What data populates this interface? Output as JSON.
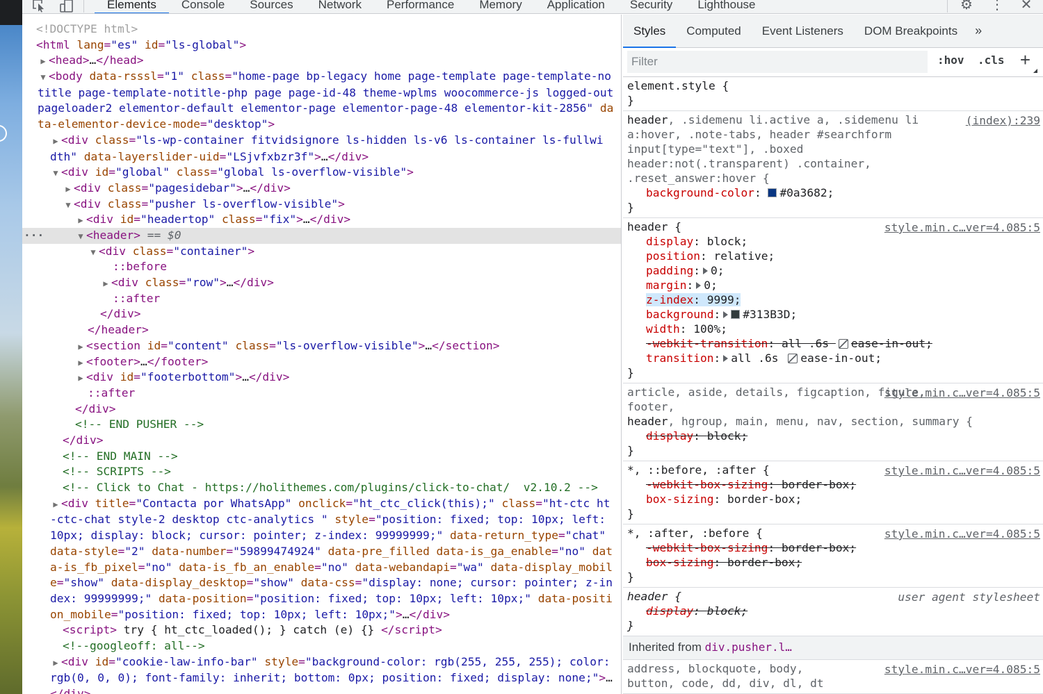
{
  "toolbar": {
    "tabs": [
      "Elements",
      "Console",
      "Sources",
      "Network",
      "Performance",
      "Memory",
      "Application",
      "Security",
      "Lighthouse"
    ],
    "active_tab": "Elements",
    "icons": [
      "inspect-element-icon",
      "device-toolbar-icon",
      "settings-gear-icon",
      "more-options-icon",
      "close-icon"
    ]
  },
  "elements": {
    "selected_suffix": "== $0",
    "lines": {
      "l0": "<!DOCTYPE html>",
      "l1_lang": "\"es\"",
      "l1_id": "\"ls-global\"",
      "l2_head": "…",
      "l3_rsssl": "\"1\"",
      "l3_class": "\"home-page bp-legacy home page-template page-template-notitle page-template-notitle-php page page-id-48 theme-wplms woocommerce-js logged-out pageloader2 elementor-default elementor-page elementor-page-48 elementor-kit-2856\"",
      "l3_mode": "\"desktop\"",
      "l4_class": "\"ls-wp-container fitvidsignore ls-hidden ls-v6 ls-container ls-fullwidth\"",
      "l4_uid": "\"LSjvfxbzr3f\"",
      "l5_id": "\"global\"",
      "l5_class": "\"global ls-overflow-visible\"",
      "l6_class": "\"pagesidebar\"",
      "l7_class": "\"pusher ls-overflow-visible\"",
      "l8_id": "\"headertop\"",
      "l8_class": "\"fix\"",
      "l10_class": "\"container\"",
      "l11": "::before",
      "l12_class": "\"row\"",
      "l13": "::after",
      "l16_id": "\"content\"",
      "l16_class": "\"ls-overflow-visible\"",
      "l18_id": "\"footerbottom\"",
      "l19": "::after",
      "c1": "<!-- END PUSHER -->",
      "c2": "<!-- END MAIN -->",
      "c3": "<!-- SCRIPTS -->",
      "c4": "<!-- Click to Chat - https://holithemes.com/plugins/click-to-chat/  v2.10.2 -->",
      "wa_title": "\"Contacta por WhatsApp\"",
      "wa_onclick": "\"ht_ctc_click(this);\"",
      "wa_class": "\"ht-ctc ht-ctc-chat style-2 desktop ctc-analytics \"",
      "wa_style": "\"position: fixed; top: 10px; left: 10px; display: block; cursor: pointer; z-index: 99999999;\"",
      "wa_return": "\"chat\"",
      "wa_dstyle": "\"2\"",
      "wa_number": "\"59899474924\"",
      "wa_ga": "\"no\"",
      "wa_fbpx": "\"no\"",
      "wa_fban": "\"no\"",
      "wa_api": "\"wa\"",
      "wa_mob": "\"show\"",
      "wa_desk": "\"show\"",
      "wa_css": "\"display: none; cursor: pointer; z-index: 99999999;\"",
      "wa_pos": "\"position: fixed; top: 10px; left: 10px;\"",
      "wa_posm": "\"position: fixed; top: 10px; left: 10px;\"",
      "script_body": " try { ht_ctc_loaded(); } catch (e) {} ",
      "c5": "<!--googleoff: all-->",
      "ck_id": "\"cookie-law-info-bar\"",
      "ck_style": "\"background-color: rgb(255, 255, 255); color: rgb(0, 0, 0); font-family: inherit; bottom: 0px; position: fixed; display: none;\""
    }
  },
  "side": {
    "tabs": [
      "Styles",
      "Computed",
      "Event Listeners",
      "DOM Breakpoints"
    ],
    "active_tab": "Styles",
    "filter_placeholder": "Filter",
    "hov": ":hov",
    "cls": ".cls",
    "rules": {
      "r0_sel": "element.style {",
      "r1_src": "(index):239",
      "r1_sel_a": "header",
      "r1_sel_b": ", .sidemenu li.active a, .sidemenu li a:hover, .note-tabs, header #searchform input[type=\"text\"], .boxed header:not(.transparent) .container, .reset_answer:hover {",
      "r1_val": "#0a3682",
      "r2_src": "style.min.c…ver=4.085:5",
      "r2_sel": "header",
      "r2_display": "block",
      "r2_position": "relative",
      "r2_padding": "0",
      "r2_margin": "0",
      "r2_z": "9999",
      "r2_bg": "#313B3D",
      "r2_width": "100%",
      "r2_webkit": "all .6s",
      "r2_webkit_ease": "ease-in-out",
      "r2_trans": "all .6s",
      "r2_trans_ease": "ease-in-out",
      "r3_src": "style.min.c…ver=4.085:5",
      "r3_sel_a": "article, aside, details, figcaption, figure, footer,",
      "r3_sel_b": "header",
      "r3_sel_c": ", hgroup, main, menu, nav, section, summary {",
      "r3_display": "block",
      "r4_src": "style.min.c…ver=4.085:5",
      "r4_sel": "*, ::before, :after {",
      "r4_wk": "border-box",
      "r4_bs": "border-box",
      "r5_src": "style.min.c…ver=4.085:5",
      "r5_sel": "*, :after, :before {",
      "r5_wk": "border-box",
      "r5_bs": "border-box",
      "r6_src": "user agent stylesheet",
      "r6_sel": "header",
      "r6_display": "block",
      "inherited_label": "Inherited from",
      "inherited_node": "div.pusher.l…",
      "r7_src": "style.min.c…ver=4.085:5",
      "r7_sel": "address, blockquote, body,",
      "r7_sel2": "button, code, dd, div, dl, dt"
    }
  },
  "colors": {
    "accent": "#1a73e8",
    "tag": "#881280",
    "attr": "#994500",
    "value": "#1a1aa6",
    "comment": "#236e25",
    "prop": "#c80000"
  }
}
